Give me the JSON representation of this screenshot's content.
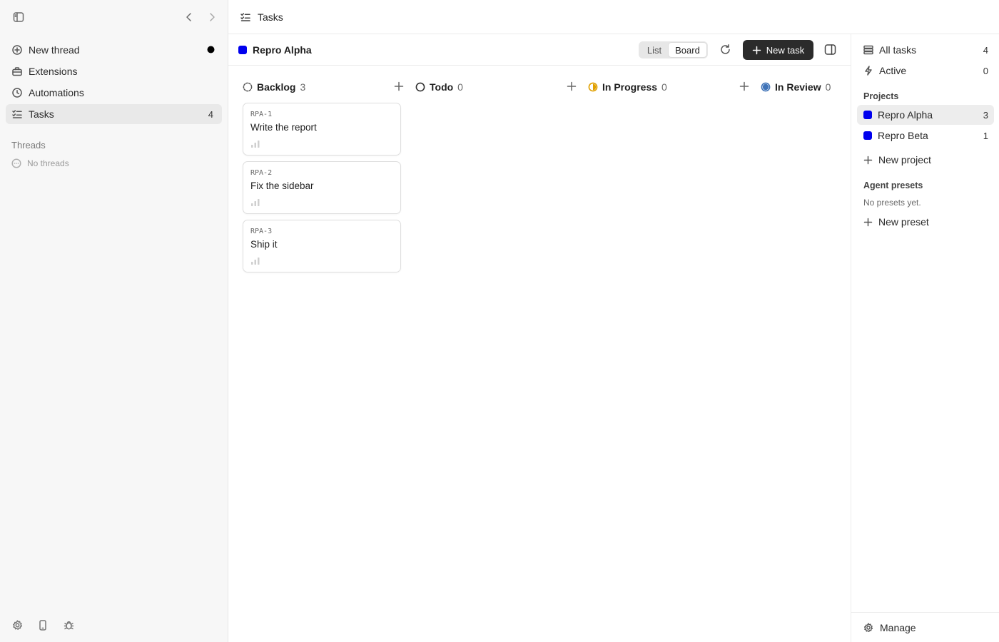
{
  "sidebar": {
    "nav": [
      {
        "label": "New thread",
        "icon": "plus-circle-icon"
      },
      {
        "label": "Extensions",
        "icon": "toolbox-icon"
      },
      {
        "label": "Automations",
        "icon": "clock-icon"
      },
      {
        "label": "Tasks",
        "icon": "checklist-icon",
        "count": "4",
        "active": true
      }
    ],
    "threads_heading": "Threads",
    "no_threads": "No threads"
  },
  "header": {
    "title": "Tasks"
  },
  "toolbar": {
    "project_name": "Repro Alpha",
    "project_color": "#0000ee",
    "view_list": "List",
    "view_board": "Board",
    "active_view": "Board",
    "new_task_label": "New task"
  },
  "columns": [
    {
      "label": "Backlog",
      "count": "3",
      "status_icon": "dashed-circle-icon",
      "cards": [
        {
          "key": "RPA-1",
          "title": "Write the report"
        },
        {
          "key": "RPA-2",
          "title": "Fix the sidebar"
        },
        {
          "key": "RPA-3",
          "title": "Ship it"
        }
      ]
    },
    {
      "label": "Todo",
      "count": "0",
      "status_icon": "circle-icon",
      "cards": []
    },
    {
      "label": "In Progress",
      "count": "0",
      "status_icon": "half-circle-icon",
      "status_color": "#e0a000",
      "cards": []
    },
    {
      "label": "In Review",
      "count": "0",
      "status_icon": "filled-circle-icon",
      "status_color": "#3f73b8",
      "cards": []
    }
  ],
  "right_panel": {
    "all_tasks": {
      "label": "All tasks",
      "count": "4"
    },
    "active": {
      "label": "Active",
      "count": "0"
    },
    "projects_heading": "Projects",
    "projects": [
      {
        "label": "Repro Alpha",
        "count": "3",
        "color": "#0000ee",
        "active": true
      },
      {
        "label": "Repro Beta",
        "count": "1",
        "color": "#0000ee"
      }
    ],
    "new_project": "New project",
    "presets_heading": "Agent presets",
    "no_presets": "No presets yet.",
    "new_preset": "New preset",
    "manage": "Manage"
  }
}
